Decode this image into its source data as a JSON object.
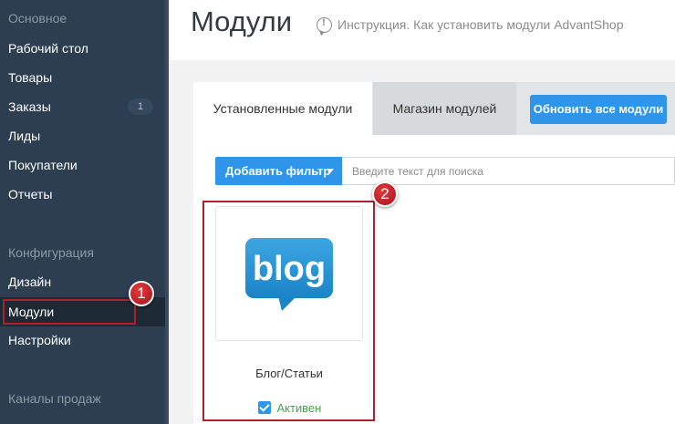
{
  "sidebar": {
    "section_main": "Основное",
    "items_main": [
      {
        "label": "Рабочий стол"
      },
      {
        "label": "Товары"
      },
      {
        "label": "Заказы",
        "badge": "1"
      },
      {
        "label": "Лиды"
      },
      {
        "label": "Покупатели"
      },
      {
        "label": "Отчеты"
      }
    ],
    "section_config": "Конфигурация",
    "items_config": [
      {
        "label": "Дизайн"
      },
      {
        "label": "Модули",
        "active": true
      },
      {
        "label": "Настройки"
      }
    ],
    "section_channels": "Каналы продаж"
  },
  "header": {
    "title": "Модули",
    "help_icon": "speech-bubble-info-icon",
    "help_link": "Инструкция. Как установить модули AdvantShop"
  },
  "tabs": [
    {
      "label": "Установленные модули",
      "active": true
    },
    {
      "label": "Магазин модулей",
      "active": false
    }
  ],
  "refresh_button": "Обновить все модули",
  "filter": {
    "add_filter_label": "Добавить фильтр",
    "search_placeholder": "Введите текст для поиска",
    "search_value": ""
  },
  "modules": [
    {
      "title": "Блог/Статьи",
      "status": "Активен",
      "enabled": true,
      "logo_text": "blog"
    }
  ],
  "markers": [
    {
      "number": "1"
    },
    {
      "number": "2"
    }
  ],
  "colors": {
    "sidebar_bg": "#2c3e50",
    "accent_blue": "#2f95ea",
    "status_green": "#4aa34f",
    "highlight_red": "#b11f2c"
  }
}
